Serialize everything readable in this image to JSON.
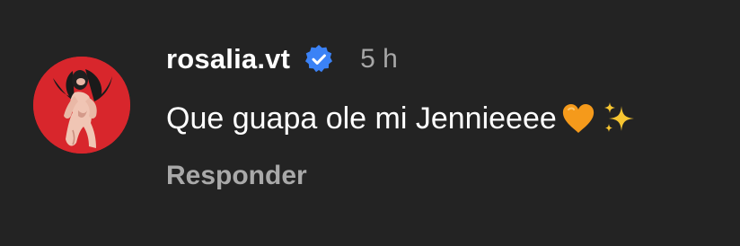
{
  "comment": {
    "username": "rosalia.vt",
    "verified_icon": "verified-badge-icon",
    "timestamp": "5 h",
    "text": "Que guapa ole mi Jennieeee",
    "emojis": [
      "orange-heart-emoji",
      "sparkles-emoji"
    ],
    "reply_label": "Responder"
  },
  "colors": {
    "background": "#232323",
    "avatar_bg": "#d8262c",
    "verified": "#3b82f6",
    "muted_text": "#a7a7a7"
  }
}
